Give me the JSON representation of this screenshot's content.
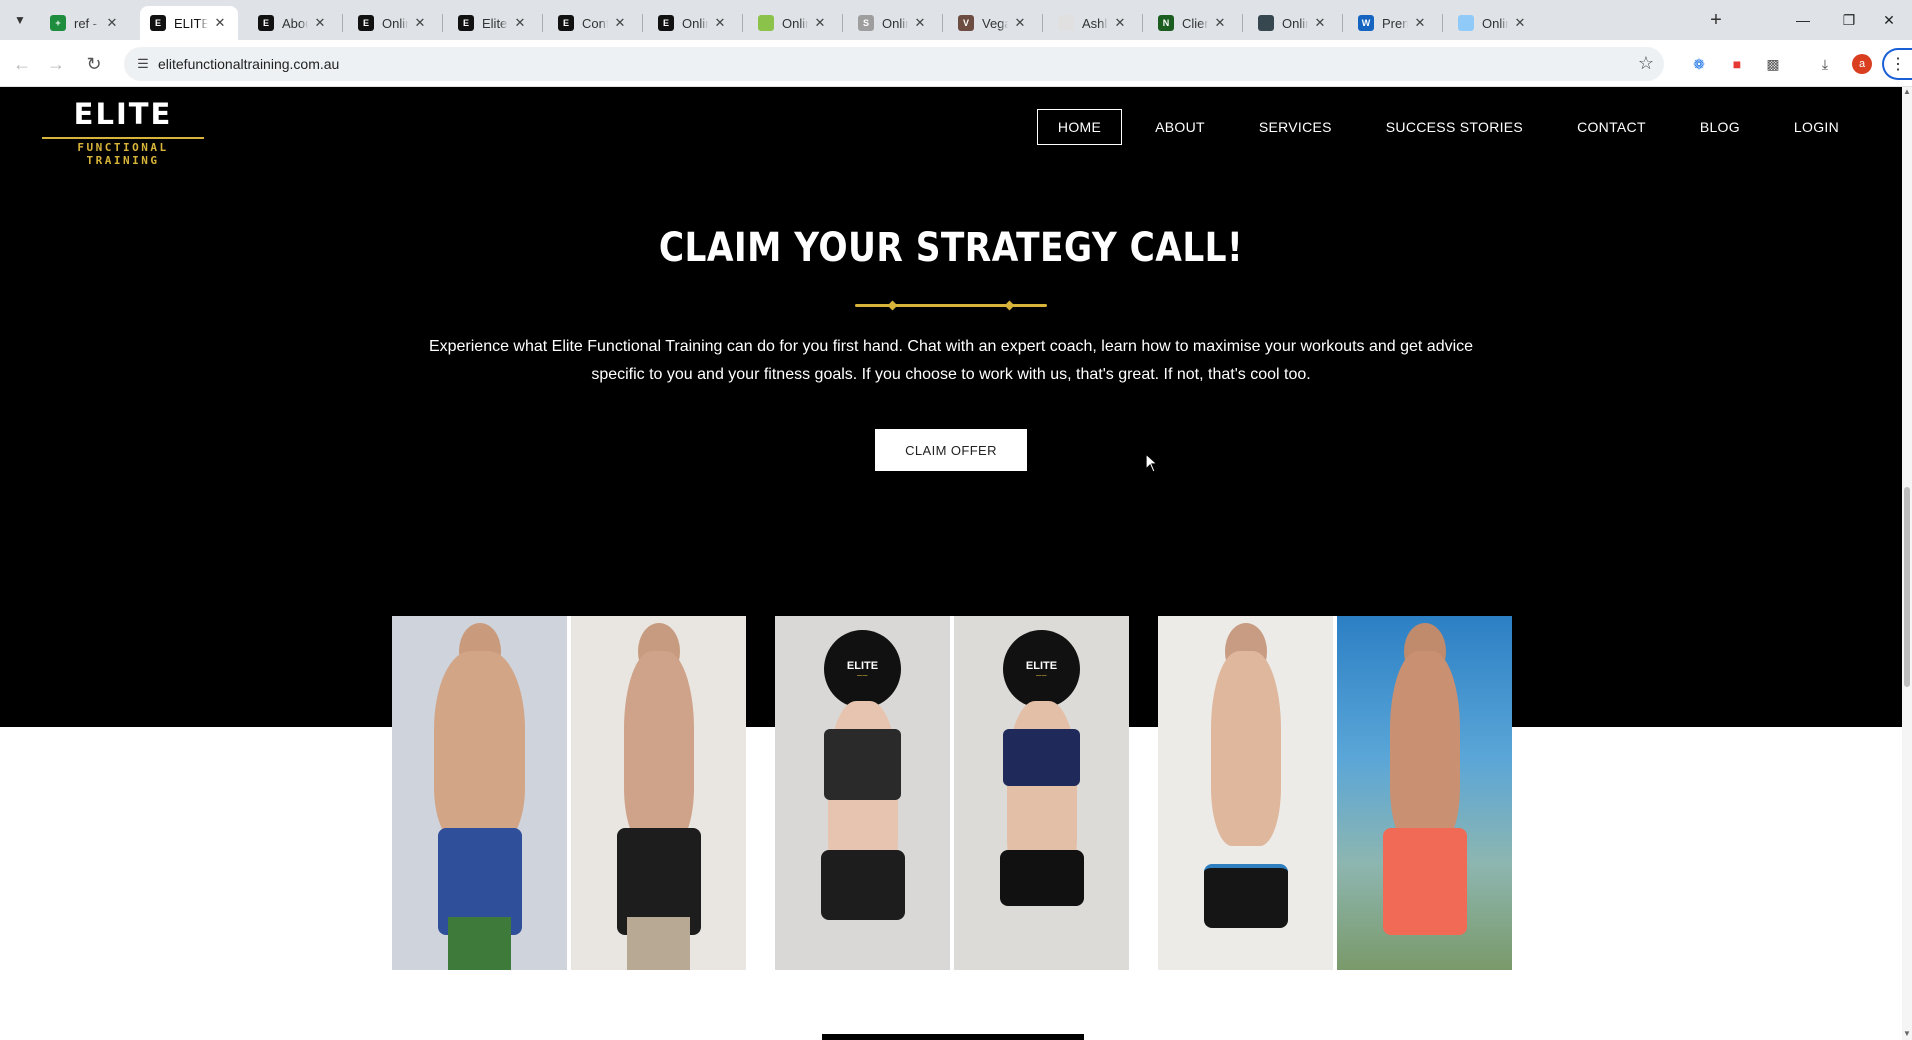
{
  "browser": {
    "tabs": [
      {
        "title": "ref - Go",
        "favicon_color": "#1e8e3e",
        "favicon_glyph": "+",
        "active": false
      },
      {
        "title": "ELITE F",
        "favicon_color": "#111111",
        "favicon_glyph": "E",
        "active": true
      },
      {
        "title": "About E",
        "favicon_color": "#111111",
        "favicon_glyph": "E",
        "active": false
      },
      {
        "title": "Online",
        "favicon_color": "#111111",
        "favicon_glyph": "E",
        "active": false
      },
      {
        "title": "Elite Fu",
        "favicon_color": "#111111",
        "favicon_glyph": "E",
        "active": false
      },
      {
        "title": "Contact",
        "favicon_color": "#111111",
        "favicon_glyph": "E",
        "active": false
      },
      {
        "title": "Online",
        "favicon_color": "#111111",
        "favicon_glyph": "E",
        "active": false
      },
      {
        "title": "Online",
        "favicon_color": "#8bc34a",
        "favicon_glyph": "",
        "active": false
      },
      {
        "title": "Online",
        "favicon_color": "#9e9e9e",
        "favicon_glyph": "S",
        "active": false
      },
      {
        "title": "Vegan",
        "favicon_color": "#6d4c41",
        "favicon_glyph": "V",
        "active": false
      },
      {
        "title": "Ashley",
        "favicon_color": "#e0e0e0",
        "favicon_glyph": "",
        "active": false
      },
      {
        "title": "Client",
        "favicon_color": "#1b5e20",
        "favicon_glyph": "N",
        "active": false
      },
      {
        "title": "Online",
        "favicon_color": "#37474f",
        "favicon_glyph": "",
        "active": false
      },
      {
        "title": "Premiu",
        "favicon_color": "#1565c0",
        "favicon_glyph": "W",
        "active": false
      },
      {
        "title": "Online",
        "favicon_color": "#90caf9",
        "favicon_glyph": "",
        "active": false
      }
    ],
    "url": "elitefunctionaltraining.com.au",
    "icons": {
      "tab_search": "chevron-down-icon",
      "new_tab": "plus-icon",
      "minimize": "minimize-icon",
      "restore": "restore-icon",
      "close": "close-icon",
      "back": "back-arrow-icon",
      "forward": "forward-arrow-icon",
      "reload": "reload-icon",
      "site_info": "site-info-icon",
      "bookmark": "star-icon",
      "downloads": "download-icon",
      "menu": "kebab-menu-icon"
    },
    "profile_initial": "a"
  },
  "site": {
    "logo": {
      "word": "ELITE",
      "sub": "FUNCTIONAL TRAINING"
    },
    "nav": [
      {
        "label": "HOME",
        "active": true
      },
      {
        "label": "ABOUT",
        "active": false
      },
      {
        "label": "SERVICES",
        "active": false
      },
      {
        "label": "SUCCESS STORIES",
        "active": false
      },
      {
        "label": "CONTACT",
        "active": false
      },
      {
        "label": "BLOG",
        "active": false
      },
      {
        "label": "LOGIN",
        "active": false
      }
    ],
    "cta": {
      "title": "CLAIM YOUR STRATEGY CALL!",
      "text": "Experience what Elite Functional Training can do for you first hand. Chat with an expert coach, learn how to maximise your workouts and get advice specific to you and your fitness goals. If you choose to work with us, that's great. If not, that's cool too.",
      "button": "CLAIM OFFER"
    },
    "stories": [
      {
        "name": "transformation-1",
        "badge": ""
      },
      {
        "name": "transformation-2",
        "badge": "ELITE"
      },
      {
        "name": "transformation-3",
        "badge": ""
      }
    ],
    "colors": {
      "brand_gold": "#d8b43a",
      "hero_bg": "#000000"
    }
  }
}
